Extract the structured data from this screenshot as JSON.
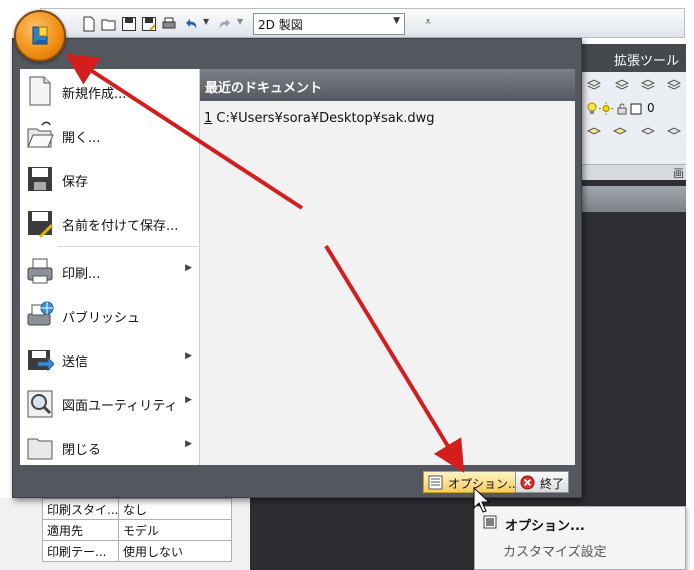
{
  "qat": {
    "workspace": "2D 製図",
    "icons": [
      "new-file-icon",
      "open-folder-icon",
      "save-icon",
      "save-as-icon",
      "plot-icon",
      "undo-icon",
      "redo-icon"
    ]
  },
  "ribbon": {
    "tab_label": "拡張ツール",
    "layer_value": "0",
    "panel_label": "画"
  },
  "properties": {
    "rows": [
      {
        "key": "印刷スタイ...",
        "value": "なし"
      },
      {
        "key": "適用先",
        "value": "モデル"
      },
      {
        "key": "印刷テー...",
        "value": "使用しない"
      }
    ]
  },
  "app_menu": {
    "items": [
      {
        "label": "新規作成...",
        "icon": "new-document-icon"
      },
      {
        "label": "開く...",
        "icon": "open-folder-icon"
      },
      {
        "label": "保存",
        "icon": "save-icon"
      },
      {
        "label": "名前を付けて保存...",
        "icon": "save-as-icon"
      },
      {
        "label": "印刷...",
        "icon": "printer-icon"
      },
      {
        "label": "パブリッシュ",
        "icon": "publish-icon"
      },
      {
        "label": "送信",
        "icon": "send-icon"
      },
      {
        "label": "図面ユーティリティ",
        "icon": "drawing-utility-icon"
      },
      {
        "label": "閉じる",
        "icon": "close-folder-icon"
      }
    ],
    "recent_header": "最近のドキュメント",
    "recent_documents": [
      {
        "number": "1",
        "path": "C:¥Users¥sora¥Desktop¥sak.dwg"
      }
    ],
    "options_button": "オプション...",
    "exit_button": "終了"
  },
  "context_menu": {
    "item1": "オプション...",
    "item2": "カスタマイズ設定"
  },
  "colors": {
    "menu_frame": "#54585e",
    "highlight": "#f7cd5f",
    "arrow": "#d41e1e",
    "app_button": "#f08b10"
  }
}
